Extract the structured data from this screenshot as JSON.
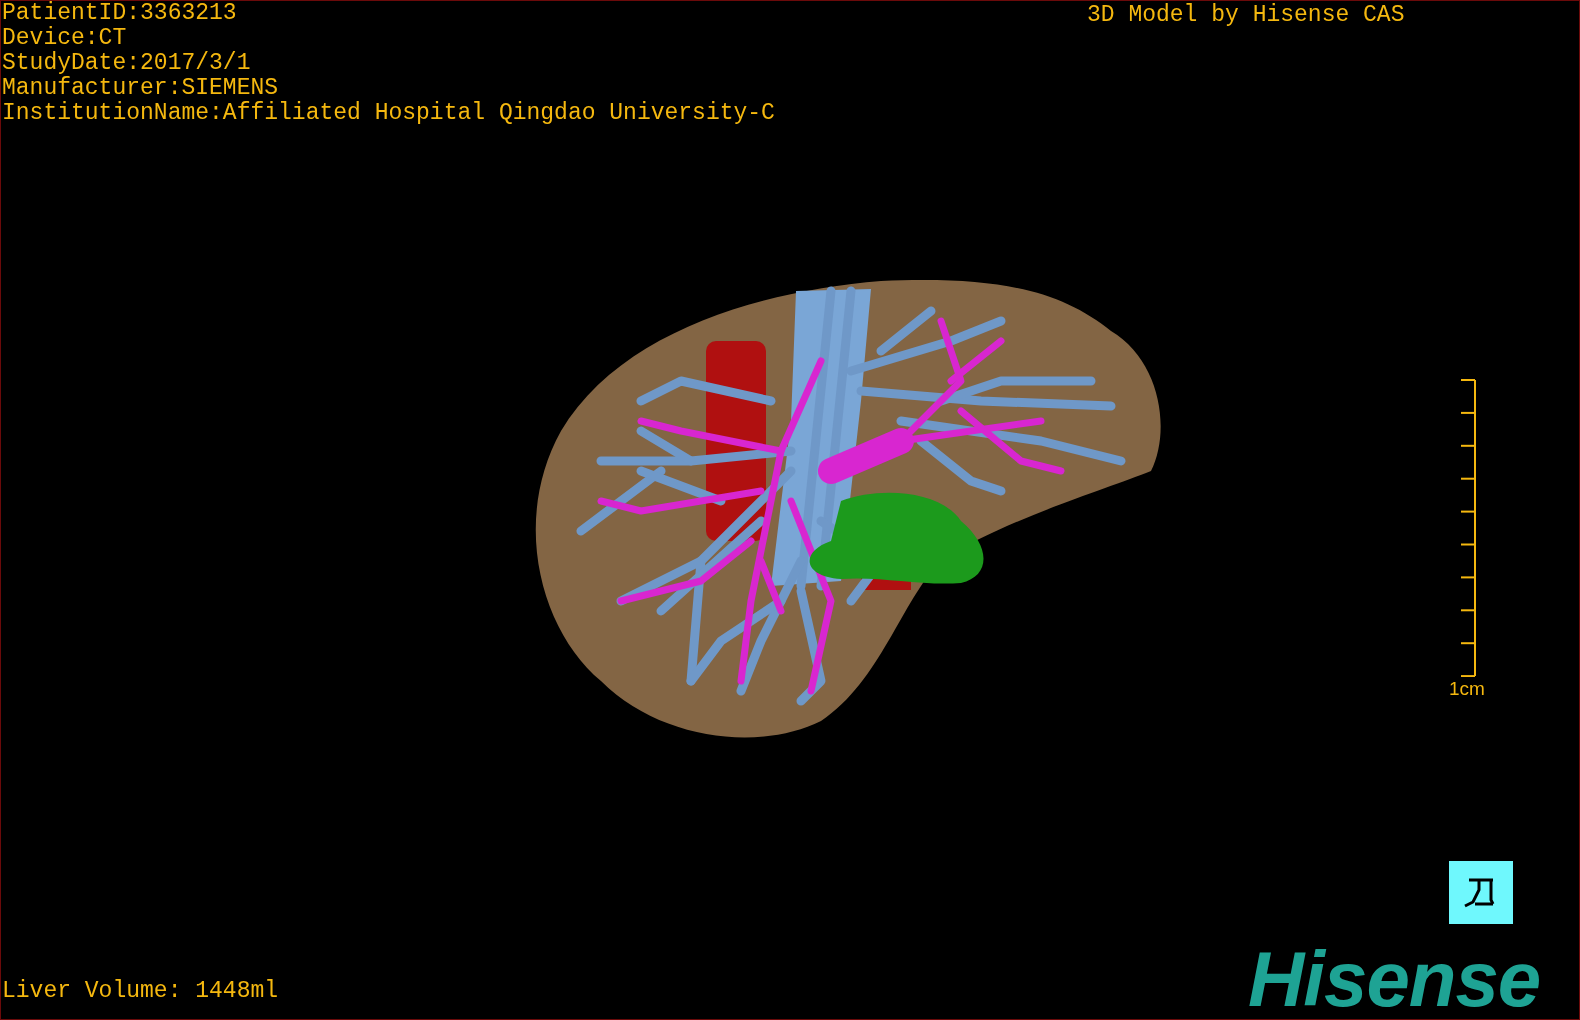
{
  "info_lines": [
    "PatientID:3363213",
    "Device:CT",
    "StudyDate:2017/3/1",
    "Manufacturer:SIEMENS",
    "InstitutionName:Affiliated Hospital Qingdao University-C"
  ],
  "credit": "3D Model by Hisense CAS",
  "scale_bar": {
    "label": "1cm"
  },
  "volume": "Liver Volume: 1448ml",
  "logo": "Hisense"
}
